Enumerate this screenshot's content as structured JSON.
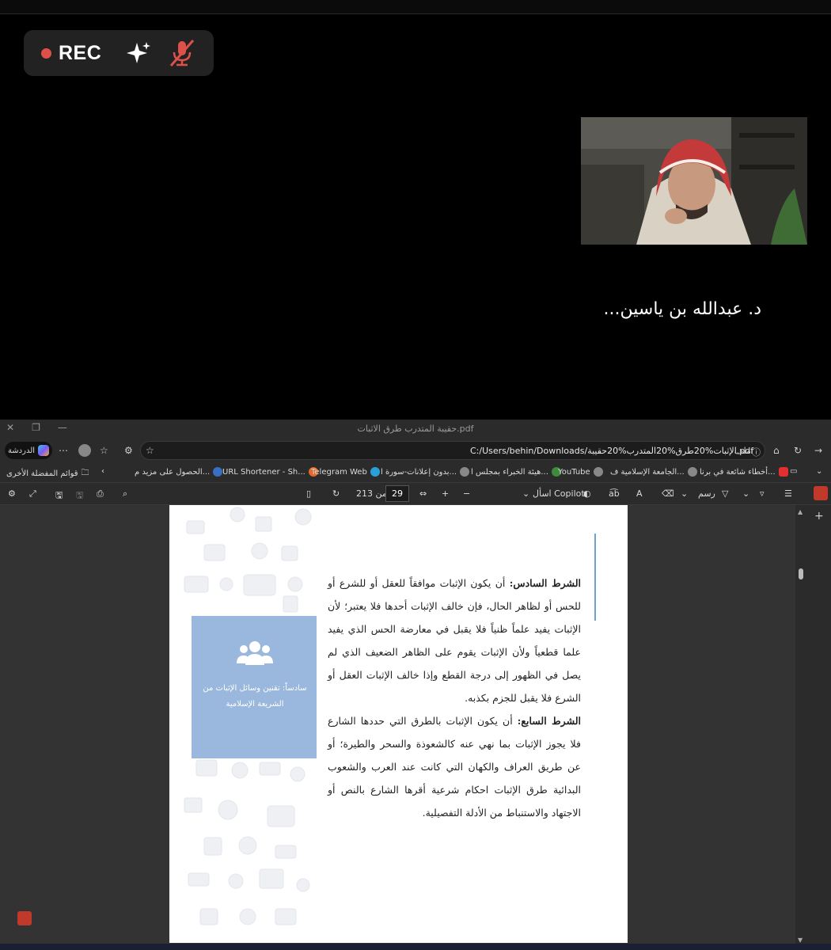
{
  "meeting": {
    "rec_label": "REC",
    "speaker_name": "د. عبدالله بن ياسين..."
  },
  "browser": {
    "window_title": "حقيبة المتدرب طرق الاثبات.pdf",
    "address": {
      "prefix_label": "ملف",
      "url": "C:/Users/behin/Downloads/الإثبات%20طرق%20المتدرب%20حقيبة.pdf"
    },
    "chat_label": "الدردشة",
    "favorites": [
      "أخطاء شائعة في برنا...",
      "الجامعة الإسلامية ف...",
      "YouTube",
      "هيئة الخبراء بمجلس ا...",
      "بدون إعلانات-سورة ا...",
      "Telegram Web",
      "URL Shortener - Sh...",
      "الحصول على مزيد م...",
      "قوائم المفضلة الأخرى"
    ],
    "pdf_toolbar": {
      "draw_label": "رسم",
      "copilot_label": "اسأل Copilot",
      "page_current": "29",
      "page_of": "من 213"
    }
  },
  "document": {
    "sidebar_box_text": "سادساً: تقنين وسائل الإثبات من الشريعة الإسلامية",
    "paragraph_6_title": "الشرط السادس:",
    "paragraph_6_body": " أن يكون الإثبات موافقاً للعقل أو للشرع أو للحس أو لظاهر الحال، فإن خالف الإثبات أحدها فلا يعتبر؛ لأن الإثبات يفيد علماً ظنياً فلا يقبل في معارضة الحس الذي يفيد علما قطعياً ولأن الإثبات يقوم على الظاهر الضعيف الذي لم يصل في الظهور إلى درجة القطع وإذا خالف الإثبات العقل أو الشرع فلا يقبل للجزم بكذبه.",
    "paragraph_7_title": "الشرط السابع:",
    "paragraph_7_body": " أن يكون الإثبات بالطرق التي حددها الشارع فلا يجوز الإثبات بما نهي عنه كالشعوذة والسحر والطيرة؛ أو عن طريق العراف والكهان التي كانت عند العرب والشعوب البدائية طرق الإثبات احكام شرعية أقرها الشارع بالنص أو الاجتهاد والاستنباط من الأدلة التفصيلية."
  }
}
